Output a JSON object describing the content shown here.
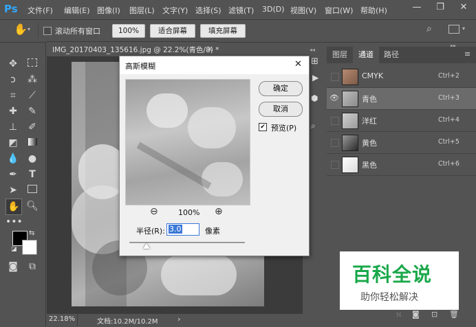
{
  "menubar": {
    "logo": "Ps",
    "items": [
      "文件(F)",
      "编辑(E)",
      "图像(I)",
      "图层(L)",
      "文字(Y)",
      "选择(S)",
      "滤镜(T)",
      "3D(D)",
      "视图(V)",
      "窗口(W)",
      "帮助(H)"
    ],
    "minimize": "—",
    "restore": "❐",
    "close": "✕"
  },
  "options": {
    "scroll_all_label": "滚动所有窗口",
    "zoom_value": "100%",
    "fit_screen": "适合屏幕",
    "fill_screen": "填充屏幕"
  },
  "document": {
    "tab_title": "IMG_20170403_135616.jpg @ 22.2%(青色/8) *",
    "tab_close": "×",
    "zoom": "22.18%",
    "doc_size": "文档:10.2M/10.2M",
    "status_arrow": "›"
  },
  "dialog": {
    "title": "高斯模糊",
    "close": "✕",
    "ok": "确定",
    "cancel": "取消",
    "preview_label": "预览(P)",
    "preview_checked": true,
    "zoom_out": "⊖",
    "zoom_level": "100%",
    "zoom_in": "⊕",
    "radius_label": "半径(R):",
    "radius_value": "3.0",
    "radius_unit": "像素",
    "radius_slider_fraction": 0.15
  },
  "panel": {
    "tabs": [
      "图层",
      "通道",
      "路径"
    ],
    "active_tab": 1,
    "channels": [
      {
        "name": "CMYK",
        "shortcut": "Ctrl+2",
        "visible": false,
        "selected": false
      },
      {
        "name": "青色",
        "shortcut": "Ctrl+3",
        "visible": true,
        "selected": true
      },
      {
        "name": "洋红",
        "shortcut": "Ctrl+4",
        "visible": false,
        "selected": false
      },
      {
        "name": "黄色",
        "shortcut": "Ctrl+5",
        "visible": false,
        "selected": false
      },
      {
        "name": "黑色",
        "shortcut": "Ctrl+6",
        "visible": false,
        "selected": false
      }
    ]
  },
  "watermark": {
    "title": "百科全说",
    "subtitle": "助你轻松解决"
  },
  "colors": {
    "ps_blue": "#31a8ff",
    "watermark_green": "#1aa84a",
    "selection_highlight": "#6b6b6b",
    "radius_selection": "#3b78d8"
  }
}
